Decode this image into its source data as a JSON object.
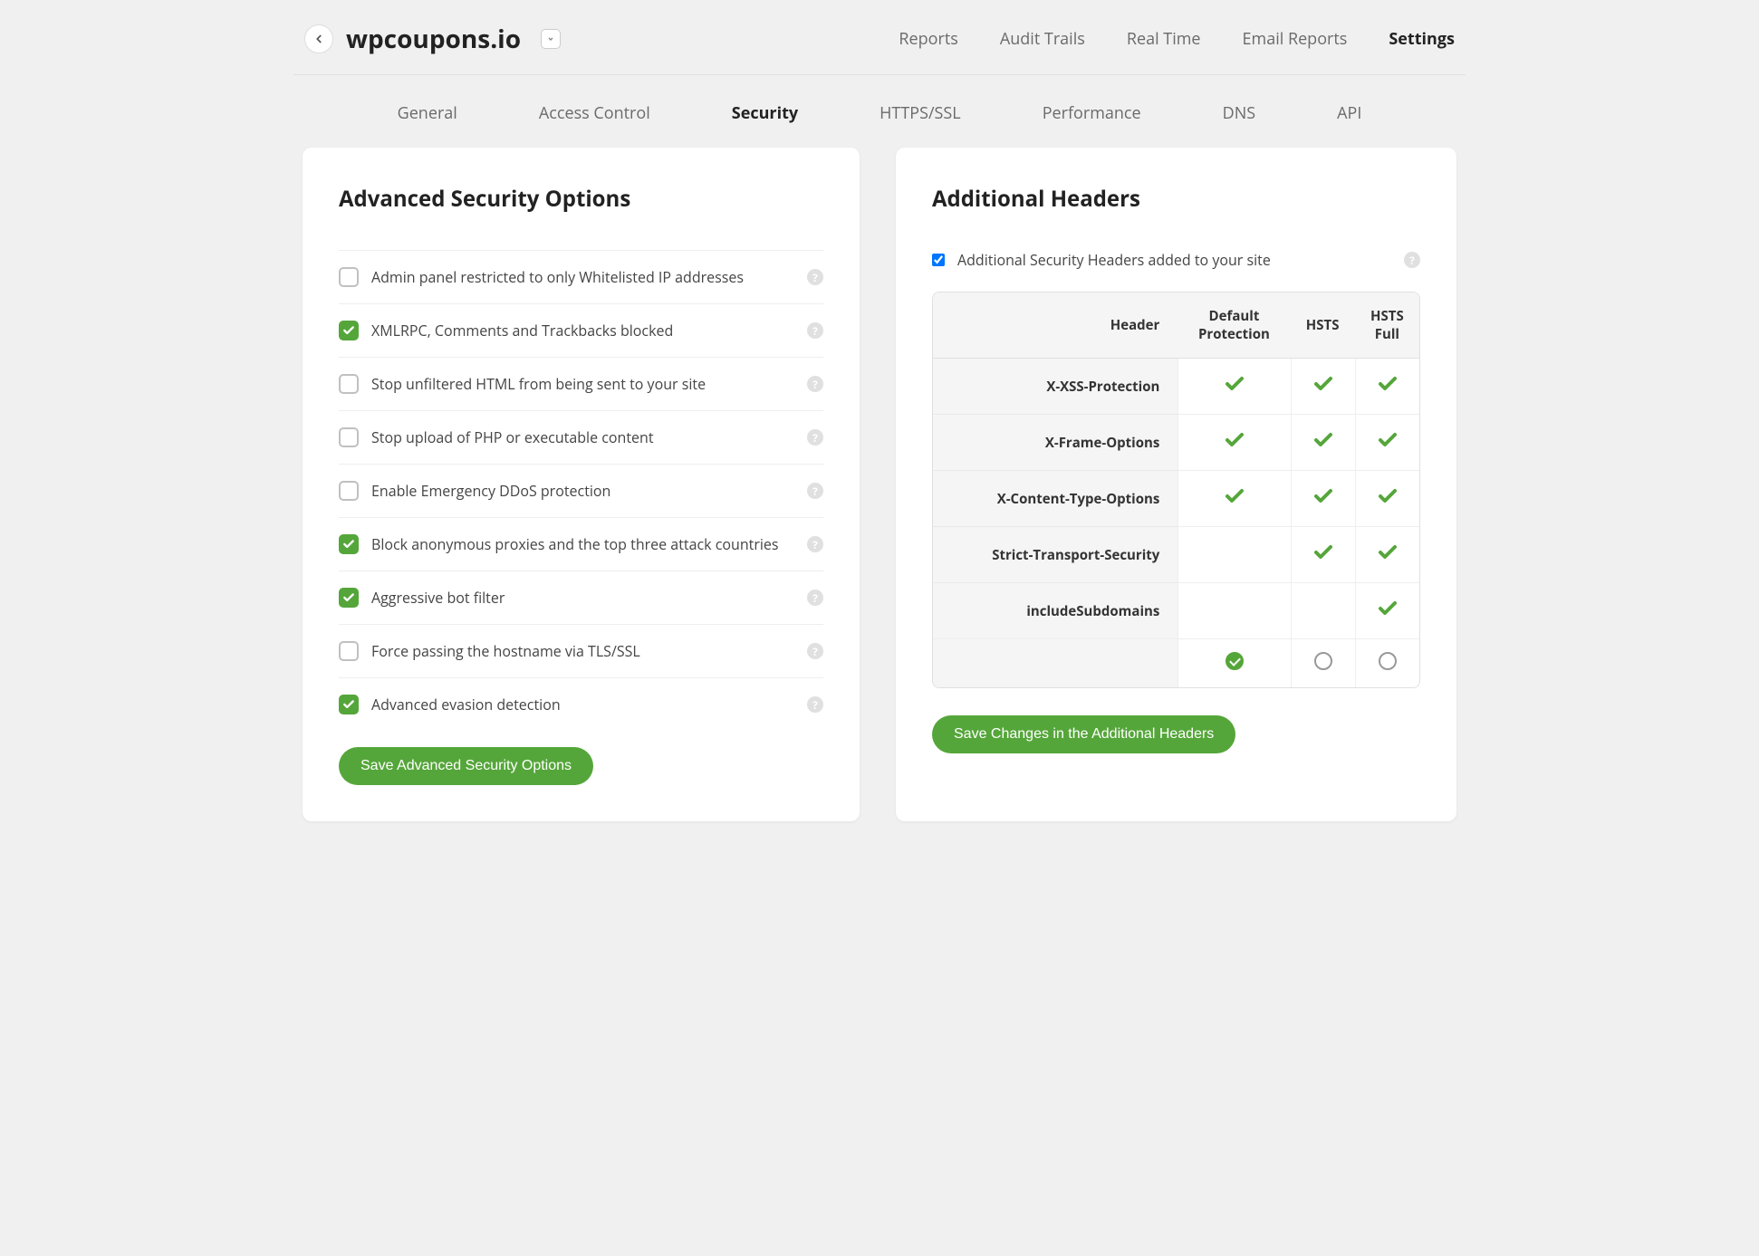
{
  "header": {
    "site_name": "wpcoupons.io",
    "topnav": [
      {
        "label": "Reports",
        "active": false
      },
      {
        "label": "Audit Trails",
        "active": false
      },
      {
        "label": "Real Time",
        "active": false
      },
      {
        "label": "Email Reports",
        "active": false
      },
      {
        "label": "Settings",
        "active": true
      }
    ],
    "subnav": [
      {
        "label": "General",
        "active": false
      },
      {
        "label": "Access Control",
        "active": false
      },
      {
        "label": "Security",
        "active": true
      },
      {
        "label": "HTTPS/SSL",
        "active": false
      },
      {
        "label": "Performance",
        "active": false
      },
      {
        "label": "DNS",
        "active": false
      },
      {
        "label": "API",
        "active": false
      }
    ]
  },
  "left_panel": {
    "title": "Advanced Security Options",
    "options": [
      {
        "label": "Admin panel restricted to only Whitelisted IP addresses",
        "checked": false
      },
      {
        "label": "XMLRPC, Comments and Trackbacks blocked",
        "checked": true
      },
      {
        "label": "Stop unfiltered HTML from being sent to your site",
        "checked": false
      },
      {
        "label": "Stop upload of PHP or executable content",
        "checked": false
      },
      {
        "label": "Enable Emergency DDoS protection",
        "checked": false
      },
      {
        "label": "Block anonymous proxies and the top three attack countries",
        "checked": true
      },
      {
        "label": "Aggressive bot filter",
        "checked": true
      },
      {
        "label": "Force passing the hostname via TLS/SSL",
        "checked": false
      },
      {
        "label": "Advanced evasion detection",
        "checked": true
      }
    ],
    "save_label": "Save Advanced Security Options"
  },
  "right_panel": {
    "title": "Additional Headers",
    "enable_label": "Additional Security Headers added to your site",
    "enable_checked": true,
    "table": {
      "col_header": "Header",
      "columns": [
        "Default Protection",
        "HSTS",
        "HSTS Full"
      ],
      "rows": [
        {
          "header": "X-XSS-Protection",
          "cells": [
            true,
            true,
            true
          ]
        },
        {
          "header": "X-Frame-Options",
          "cells": [
            true,
            true,
            true
          ]
        },
        {
          "header": "X-Content-Type-Options",
          "cells": [
            true,
            true,
            true
          ]
        },
        {
          "header": "Strict-Transport-Security",
          "cells": [
            false,
            true,
            true
          ]
        },
        {
          "header": "includeSubdomains",
          "cells": [
            false,
            false,
            true
          ]
        }
      ],
      "selected_column": 0
    },
    "save_label": "Save Changes in the Additional Headers"
  }
}
